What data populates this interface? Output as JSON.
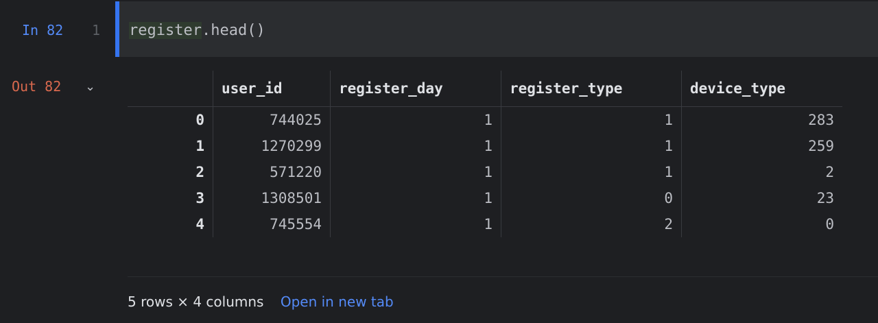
{
  "input_cell": {
    "prompt": "In 82",
    "line_number": "1",
    "code_ident": "register",
    "code_rest": ".head()"
  },
  "output_cell": {
    "prompt": "Out 82",
    "chevron": "⌄"
  },
  "table": {
    "columns": [
      "",
      "user_id",
      "register_day",
      "register_type",
      "device_type"
    ],
    "rows": [
      [
        "0",
        "744025",
        "1",
        "1",
        "283"
      ],
      [
        "1",
        "1270299",
        "1",
        "1",
        "259"
      ],
      [
        "2",
        "571220",
        "1",
        "1",
        "2"
      ],
      [
        "3",
        "1308501",
        "1",
        "0",
        "23"
      ],
      [
        "4",
        "745554",
        "1",
        "2",
        "0"
      ]
    ]
  },
  "footer": {
    "summary": "5 rows × 4 columns",
    "open_link": "Open in new tab"
  }
}
